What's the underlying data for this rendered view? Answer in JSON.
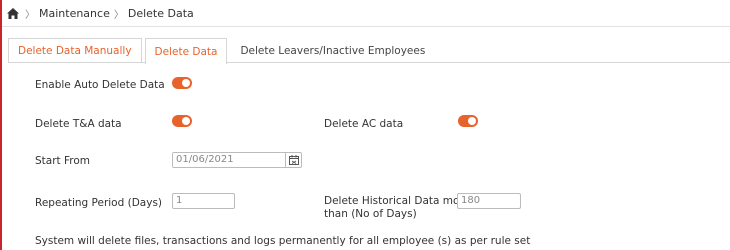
{
  "breadcrumb": {
    "home_icon": "home-icon",
    "items": [
      "Maintenance",
      "Delete Data"
    ]
  },
  "tabs": [
    {
      "label": "Delete Data Manually"
    },
    {
      "label": "Delete Data"
    },
    {
      "label": "Delete Leavers/Inactive Employees"
    }
  ],
  "form": {
    "enable_auto_delete": {
      "label": "Enable Auto Delete Data",
      "on": true
    },
    "delete_ta": {
      "label": "Delete T&A data",
      "on": true
    },
    "delete_ac": {
      "label": "Delete AC data",
      "on": true
    },
    "start_from": {
      "label": "Start From",
      "value": "01/06/2021"
    },
    "repeating_period": {
      "label": "Repeating Period (Days)",
      "value": "1"
    },
    "historical": {
      "label_line1": "Delete Historical Data more",
      "label_line2": "than (No of Days)",
      "value": "180"
    },
    "note": "System will delete files, transactions and logs permanently for all employee (s) as per rule set"
  },
  "colors": {
    "accent": "#e8622c",
    "border_red": "#c9252c"
  }
}
